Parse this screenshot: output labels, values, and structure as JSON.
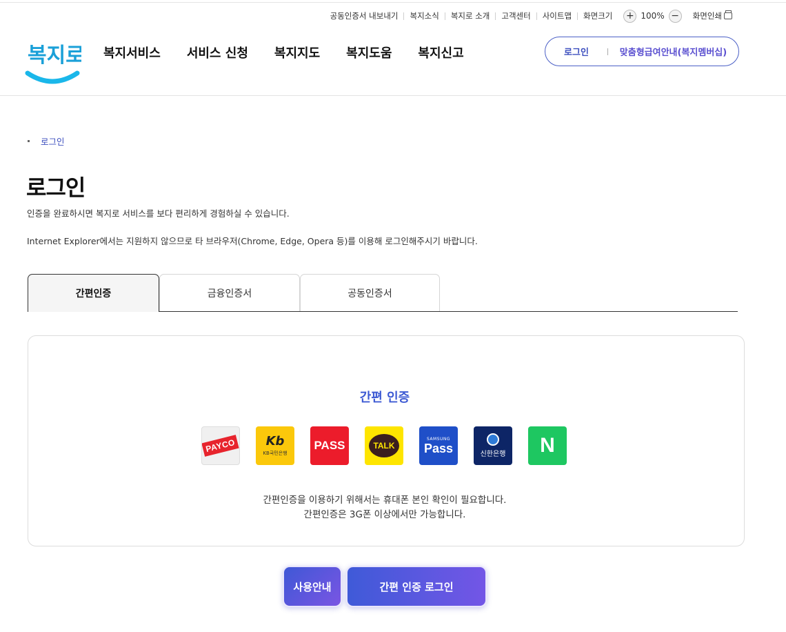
{
  "utility": {
    "links": [
      "공동인증서 내보내기",
      "복지소식",
      "복지로 소개",
      "고객센터",
      "사이트맵",
      "화면크기"
    ],
    "zoom_in": "+",
    "zoom_value": "100%",
    "zoom_out": "−",
    "print_label": "화면인쇄"
  },
  "logo_text": "복지로",
  "nav": [
    "복지서비스",
    "서비스 신청",
    "복지지도",
    "복지도움",
    "복지신고"
  ],
  "member": {
    "login": "로그인",
    "info": "맞춤형급여안내(복지멤버십)"
  },
  "breadcrumb": "로그인",
  "page": {
    "title": "로그인",
    "desc1": "인증을 완료하시면 복지로 서비스를 보다 편리하게 경험하실 수 있습니다.",
    "desc2": "Internet Explorer에서는 지원하지 않으므로 타 브라우저(Chrome, Edge, Opera 등)를 이용해 로그인해주시기 바랍니다."
  },
  "tabs": [
    "간편인증",
    "금융인증서",
    "공동인증서"
  ],
  "panel": {
    "title": "간편 인증",
    "providers": {
      "payco": "PAYCO",
      "kb_main": "Kb",
      "kb_sub": "KB국민은행",
      "pass": "PASS",
      "talk": "TALK",
      "samsung_top": "SAMSUNG",
      "samsung_main": "Pass",
      "shinhan": "신한은행",
      "naver": "N"
    },
    "note1": "간편인증을 이용하기 위해서는 휴대폰 본인 확인이 필요합니다.",
    "note2": "간편인증은 3G폰 이상에서만 가능합니다."
  },
  "buttons": {
    "guide": "사용안내",
    "login": "간편 인증 로그인"
  }
}
